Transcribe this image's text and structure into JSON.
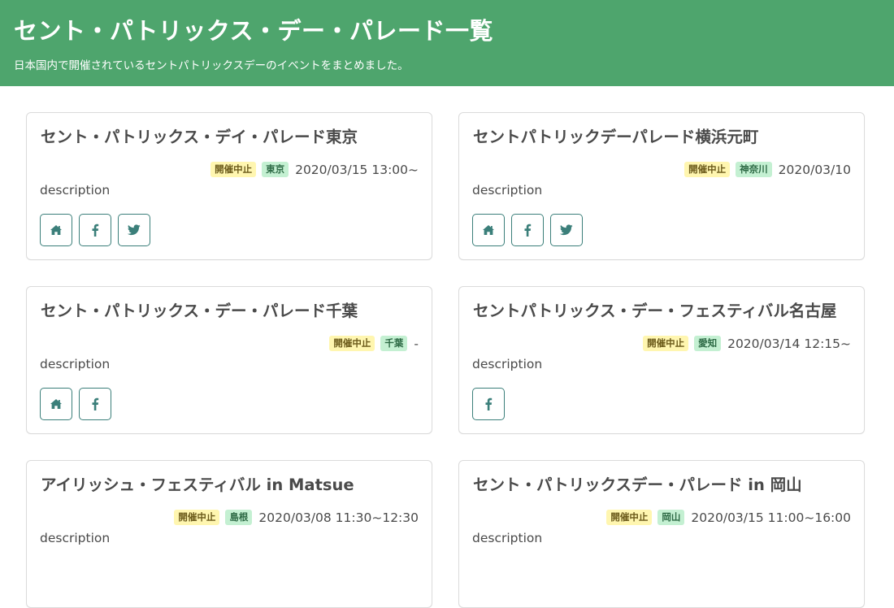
{
  "header": {
    "title": "セント・パトリックス・デー・パレード一覧",
    "subtitle": "日本国内で開催されているセントパトリックスデーのイベントをまとめました。"
  },
  "colors": {
    "header_bg": "#4ea56d",
    "status_tag_bg": "#fff6b0",
    "pref_tag_bg": "#c4f0d2",
    "button_border": "#3b7f7a"
  },
  "events": [
    {
      "title": "セント・パトリックス・デイ・パレード東京",
      "status": "開催中止",
      "prefecture": "東京",
      "date": "2020/03/15 13:00~",
      "description": "description",
      "links": [
        "home-icon",
        "facebook-icon",
        "twitter-icon"
      ]
    },
    {
      "title": "セントパトリックデーパレード横浜元町",
      "status": "開催中止",
      "prefecture": "神奈川",
      "date": "2020/03/10",
      "description": "description",
      "links": [
        "home-icon",
        "facebook-icon",
        "twitter-icon"
      ]
    },
    {
      "title": "セント・パトリックス・デー・パレード千葉",
      "status": "開催中止",
      "prefecture": "千葉",
      "date": "-",
      "description": "description",
      "links": [
        "home-icon",
        "facebook-icon"
      ]
    },
    {
      "title": "セントパトリックス・デー・フェスティバル名古屋",
      "status": "開催中止",
      "prefecture": "愛知",
      "date": "2020/03/14 12:15~",
      "description": "description",
      "links": [
        "facebook-icon"
      ]
    },
    {
      "title": "アイリッシュ・フェスティバル in Matsue",
      "status": "開催中止",
      "prefecture": "島根",
      "date": "2020/03/08 11:30~12:30",
      "description": "description",
      "links": []
    },
    {
      "title": "セント・パトリックスデー・パレード in 岡山",
      "status": "開催中止",
      "prefecture": "岡山",
      "date": "2020/03/15 11:00~16:00",
      "description": "description",
      "links": []
    }
  ]
}
